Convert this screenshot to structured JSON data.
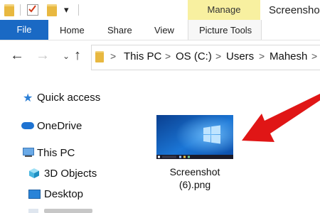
{
  "window": {
    "title": "Screenshots"
  },
  "ribbon": {
    "contextual_group": "Manage",
    "tabs": [
      {
        "label": "File"
      },
      {
        "label": "Home"
      },
      {
        "label": "Share"
      },
      {
        "label": "View"
      },
      {
        "label": "Picture Tools"
      }
    ]
  },
  "address": {
    "crumbs": [
      "This PC",
      "OS (C:)",
      "Users",
      "Mahesh"
    ],
    "separator": ">"
  },
  "nav": {
    "items": [
      {
        "label": "Quick access",
        "icon": "star-icon"
      },
      {
        "label": "OneDrive",
        "icon": "cloud-icon"
      },
      {
        "label": "This PC",
        "icon": "computer-icon"
      },
      {
        "label": "3D Objects",
        "icon": "cube-icon"
      },
      {
        "label": "Desktop",
        "icon": "desktop-icon"
      }
    ]
  },
  "file": {
    "name_line1": "Screenshot",
    "name_line2": "(6).png"
  },
  "colors": {
    "accent": "#1a69c4",
    "manage_tab": "#f8f0a0",
    "arrow": "#e01616"
  }
}
